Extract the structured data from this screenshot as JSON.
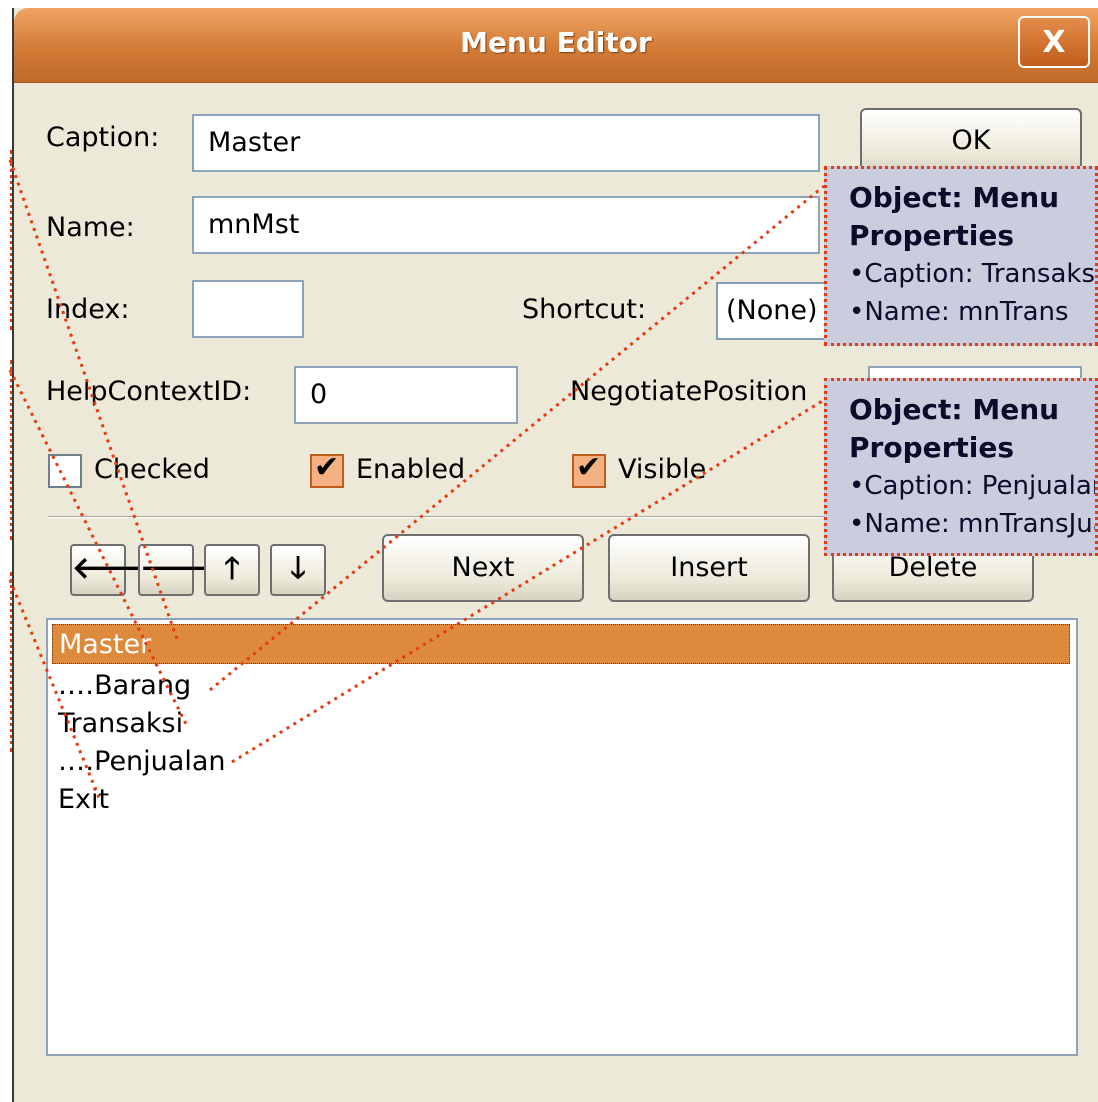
{
  "window": {
    "title": "Menu Editor",
    "close_label": "X"
  },
  "form": {
    "caption_label": "Caption:",
    "caption_value": "Master",
    "name_label": "Name:",
    "name_value": "mnMst",
    "index_label": "Index:",
    "index_value": "",
    "shortcut_label": "Shortcut:",
    "shortcut_value": "(None)",
    "helpcontext_label": "HelpContextID:",
    "helpcontext_value": "0",
    "negotiate_label": "NegotiatePosition",
    "checked_label": "Checked",
    "checked_value": false,
    "enabled_label": "Enabled",
    "enabled_value": true,
    "visible_label": "Visible",
    "visible_value": true
  },
  "buttons": {
    "ok": "OK",
    "next": "Next",
    "insert": "Insert",
    "delete": "Delete"
  },
  "arrows": [
    "left-arrow-icon",
    "right-arrow-icon",
    "up-arrow-icon",
    "down-arrow-icon"
  ],
  "menu_list": [
    {
      "text": "Master",
      "selected": true
    },
    {
      "text": "․․․․Barang",
      "selected": false
    },
    {
      "text": "Transaksi",
      "selected": false
    },
    {
      "text": "․․․․Penjualan",
      "selected": false
    },
    {
      "text": "Exit",
      "selected": false
    }
  ],
  "callouts": [
    {
      "heading1": "Object: Menu",
      "heading2": "Properties",
      "line1": "•Caption: Transaksi",
      "line2": "•Name: mnTrans"
    },
    {
      "heading1": "Object: Menu",
      "heading2": "Properties",
      "line1": "•Caption: Penjualan",
      "line2": "•Name: mnTransJual"
    }
  ],
  "colors": {
    "titlebar": "#d27b36",
    "selection": "#dd8a3c",
    "callout_bg": "#ccccdf",
    "callout_border": "#e83a10"
  }
}
